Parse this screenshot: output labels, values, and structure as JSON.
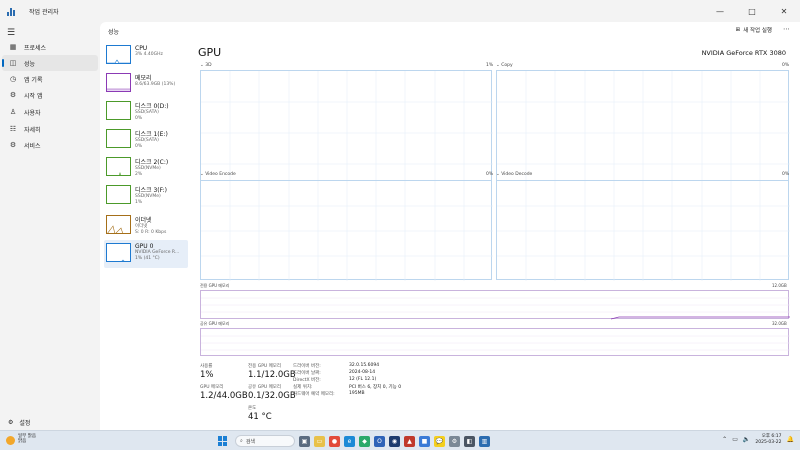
{
  "window": {
    "title": "작업 관리자",
    "controls": [
      "—",
      "□",
      "✕"
    ]
  },
  "nav": {
    "items": [
      {
        "label": "프로세스",
        "icon": "grid-icon"
      },
      {
        "label": "성능",
        "icon": "performance-icon"
      },
      {
        "label": "앱 기록",
        "icon": "history-icon"
      },
      {
        "label": "시작 앱",
        "icon": "startup-icon"
      },
      {
        "label": "사용자",
        "icon": "users-icon"
      },
      {
        "label": "자세히",
        "icon": "details-icon"
      },
      {
        "label": "서비스",
        "icon": "services-icon"
      }
    ],
    "settings_label": "설정"
  },
  "header": {
    "section_title": "성능",
    "run_task_label": "새 작업 실행"
  },
  "devices": [
    {
      "name": "CPU",
      "sub1": "3% 4.40GHz",
      "sub2": ""
    },
    {
      "name": "메모리",
      "sub1": "8.6/63.9GB (13%)",
      "sub2": ""
    },
    {
      "name": "디스크 0(D:)",
      "sub1": "SSD(SATA)",
      "sub2": "0%"
    },
    {
      "name": "디스크 1(E:)",
      "sub1": "SSD(SATA)",
      "sub2": "0%"
    },
    {
      "name": "디스크 2(C:)",
      "sub1": "SSD(NVMe)",
      "sub2": "2%"
    },
    {
      "name": "디스크 3(F:)",
      "sub1": "SSD(NVMe)",
      "sub2": "1%"
    },
    {
      "name": "이더넷",
      "sub1": "이더넷",
      "sub2": "S: 0 R: 0 Kbps"
    },
    {
      "name": "GPU 0",
      "sub1": "NVIDIA GeForce R...",
      "sub2": "1% (41 °C)"
    }
  ],
  "gpu": {
    "title": "GPU",
    "model": "NVIDIA GeForce RTX 3080",
    "graphs": [
      {
        "label": "3D",
        "pct": "1%"
      },
      {
        "label": "Copy",
        "pct": "0%"
      },
      {
        "label": "Video Encode",
        "pct": "0%"
      },
      {
        "label": "Video Decode",
        "pct": "0%"
      }
    ],
    "dedicated_label": "전용 GPU 메모리",
    "dedicated_max": "12.0GB",
    "shared_label": "공유 GPU 메모리",
    "shared_max": "32.0GB",
    "stats": {
      "util_label": "사용률",
      "util_value": "1%",
      "ded_mem_label": "전용 GPU 메모리",
      "ded_mem_value": "1.1/12.0GB",
      "gpu_mem_label": "GPU 메모리",
      "gpu_mem_value": "1.2/44.0GB",
      "shared_mem_label": "공유 GPU 메모리",
      "shared_mem_value": "0.1/32.0GB",
      "temp_label": "온도",
      "temp_value": "41 °C"
    },
    "info": [
      {
        "key": "드라이버 버전:",
        "val": "32.0.15.6094"
      },
      {
        "key": "드라이버 날짜:",
        "val": "2024-08-14"
      },
      {
        "key": "DirectX 버전:",
        "val": "12 (FL 12.1)"
      },
      {
        "key": "실제 위치:",
        "val": "PCI 버스 6, 장치 0, 기능 0"
      },
      {
        "key": "하드웨어 예약 메모리:",
        "val": "195MB"
      }
    ]
  },
  "taskbar": {
    "weather_line1": "일부 맑음",
    "weather_line2": "맑음",
    "search_placeholder": "검색",
    "time": "오후 6:17",
    "date": "2025-03-22"
  }
}
